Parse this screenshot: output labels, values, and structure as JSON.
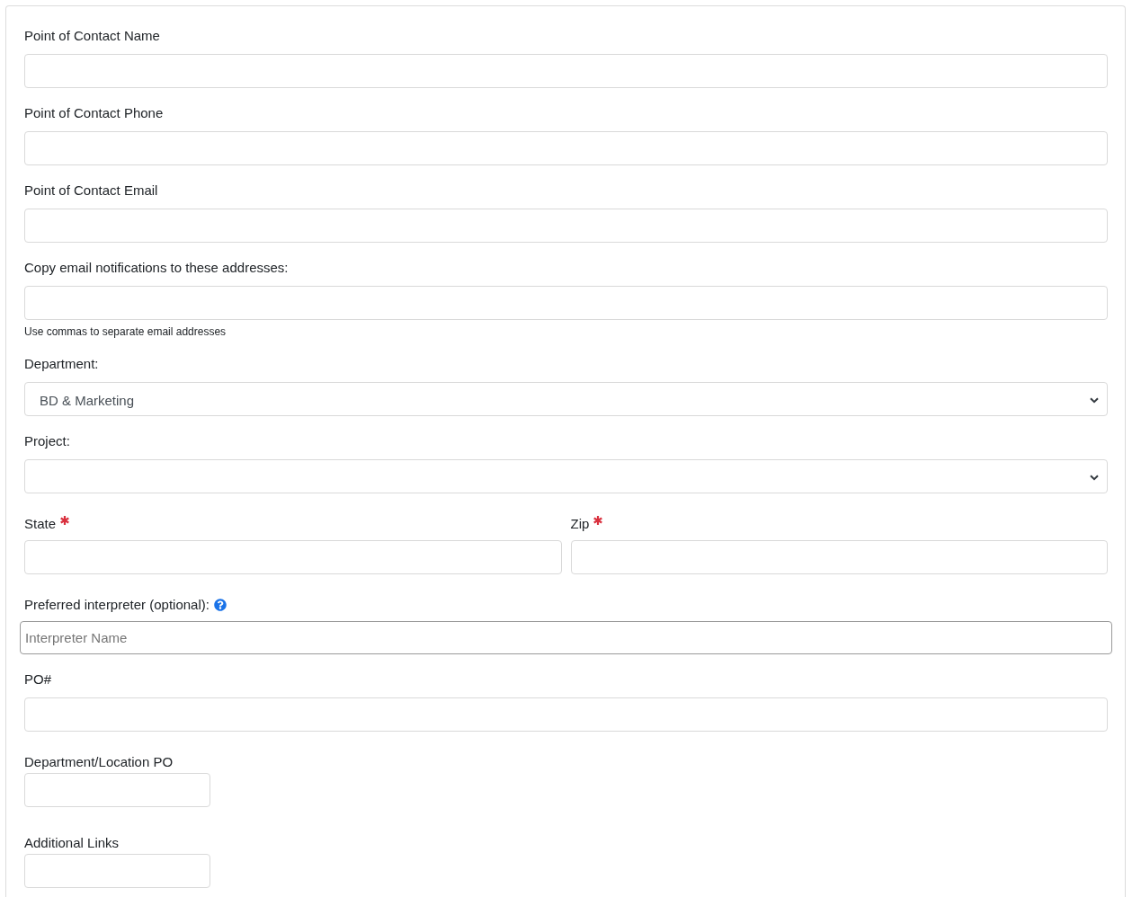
{
  "fields": [
    {
      "kind": "input",
      "label": "Point of Contact Name"
    },
    {
      "kind": "input",
      "label": "Point of Contact Phone"
    },
    {
      "kind": "input",
      "label": "Point of Contact Email"
    },
    {
      "kind": "input",
      "label": "Copy email notifications to these addresses:",
      "help": "Use commas to separate email addresses"
    },
    {
      "kind": "select",
      "label": "Department:",
      "value": "BD & Marketing"
    },
    {
      "kind": "select",
      "label": "Project:"
    },
    {
      "kind": "pair",
      "items": [
        {
          "label": "State",
          "required": true
        },
        {
          "label": "Zip",
          "required": true
        }
      ]
    },
    {
      "kind": "lookup",
      "label": "Preferred interpreter (optional):",
      "placeholder": "Interpreter Name"
    },
    {
      "kind": "input",
      "label": "PO#"
    },
    {
      "kind": "short",
      "label": "Department/Location PO"
    },
    {
      "kind": "short",
      "label": "Additional Links"
    }
  ]
}
